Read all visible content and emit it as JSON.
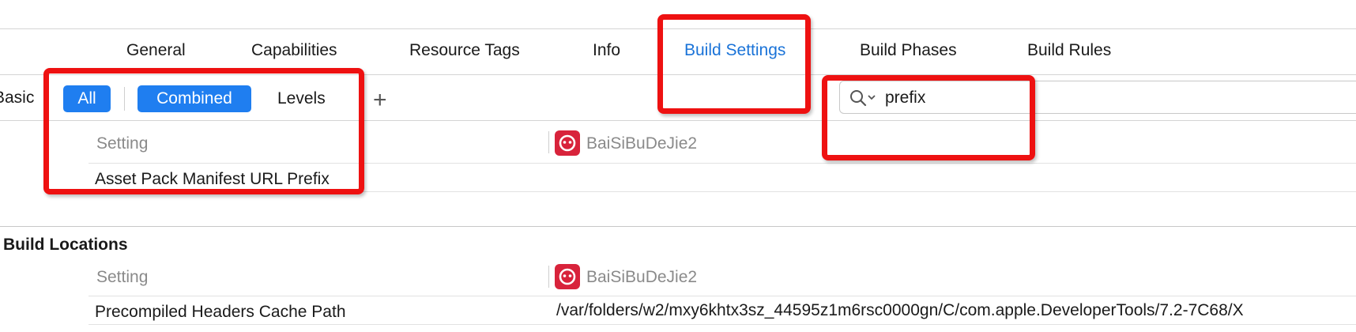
{
  "tabs": [
    {
      "label": "General"
    },
    {
      "label": "Capabilities"
    },
    {
      "label": "Resource Tags"
    },
    {
      "label": "Info"
    },
    {
      "label": "Build Settings"
    },
    {
      "label": "Build Phases"
    },
    {
      "label": "Build Rules"
    }
  ],
  "active_tab": "Build Settings",
  "filter": {
    "basic_label": "Basic",
    "all_label": "All",
    "combined_label": "Combined",
    "levels_label": "Levels",
    "add_label": "+"
  },
  "search": {
    "value": "prefix"
  },
  "top_section": {
    "setting_header": "Setting",
    "target_name": "BaiSiBuDeJie2",
    "row_label": "Asset Pack Manifest URL Prefix"
  },
  "build_locations": {
    "title": "Build Locations",
    "setting_header": "Setting",
    "target_name": "BaiSiBuDeJie2",
    "row_label": "Precompiled Headers Cache Path",
    "row_value": "/var/folders/w2/mxy6khtx3sz_44595z1m6rsc0000gn/C/com.apple.DeveloperTools/7.2-7C68/X"
  },
  "colors": {
    "accent": "#1f7ef0",
    "active_tab": "#1a73d8",
    "annotation": "#ee1111",
    "target_icon": "#d8233b"
  },
  "icons": {
    "search": "search-icon",
    "target": "target-app-icon"
  }
}
